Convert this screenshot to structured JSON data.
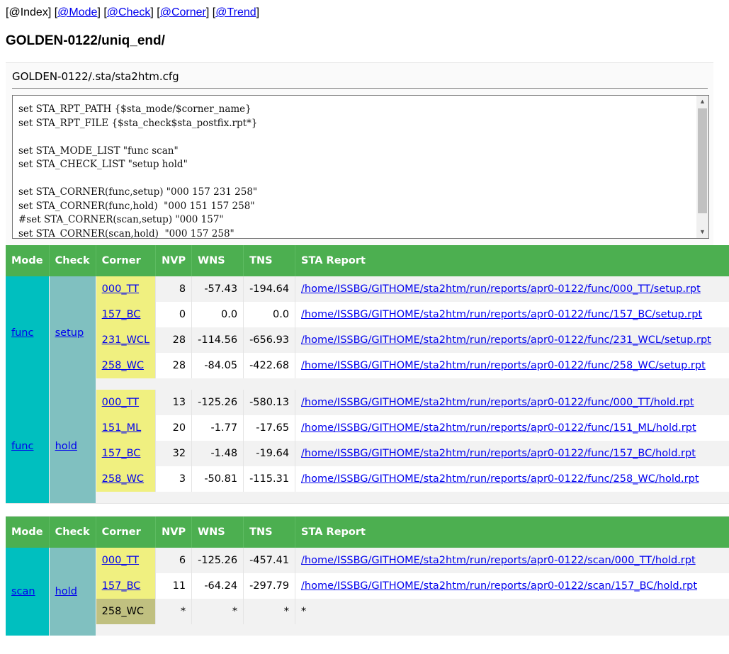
{
  "nav": {
    "index": "[@Index]",
    "links": [
      "@Mode",
      "@Check",
      "@Corner",
      "@Trend"
    ]
  },
  "title": "GOLDEN-0122/uniq_end/",
  "config": {
    "path": "GOLDEN-0122/.sta/sta2htm.cfg",
    "text": "set STA_RPT_PATH {$sta_mode/$corner_name}\nset STA_RPT_FILE {$sta_check$sta_postfix.rpt*}\n\nset STA_MODE_LIST \"func scan\"\nset STA_CHECK_LIST \"setup hold\"\n\nset STA_CORNER(func,setup) \"000 157 231 258\"\nset STA_CORNER(func,hold)  \"000 151 157 258\"\n#set STA_CORNER(scan,setup) \"000 157\"\nset STA_CORNER(scan,hold)  \"000 157 258\""
  },
  "headers": [
    "Mode",
    "Check",
    "Corner",
    "NVP",
    "WNS",
    "TNS",
    "STA Report"
  ],
  "table1": {
    "groups": [
      {
        "mode": "func",
        "check": "setup",
        "rows": [
          {
            "corner": "000_TT",
            "nvp": "8",
            "wns": "-57.43",
            "tns": "-194.64",
            "report": "/home/ISSBG/GITHOME/sta2htm/run/reports/apr0-0122/func/000_TT/setup.rpt"
          },
          {
            "corner": "157_BC",
            "nvp": "0",
            "wns": "0.0",
            "tns": "0.0",
            "report": "/home/ISSBG/GITHOME/sta2htm/run/reports/apr0-0122/func/157_BC/setup.rpt"
          },
          {
            "corner": "231_WCL",
            "nvp": "28",
            "wns": "-114.56",
            "tns": "-656.93",
            "report": "/home/ISSBG/GITHOME/sta2htm/run/reports/apr0-0122/func/231_WCL/setup.rpt"
          },
          {
            "corner": "258_WC",
            "nvp": "28",
            "wns": "-84.05",
            "tns": "-422.68",
            "report": "/home/ISSBG/GITHOME/sta2htm/run/reports/apr0-0122/func/258_WC/setup.rpt"
          }
        ]
      },
      {
        "mode": "func",
        "check": "hold",
        "rows": [
          {
            "corner": "000_TT",
            "nvp": "13",
            "wns": "-125.26",
            "tns": "-580.13",
            "report": "/home/ISSBG/GITHOME/sta2htm/run/reports/apr0-0122/func/000_TT/hold.rpt"
          },
          {
            "corner": "151_ML",
            "nvp": "20",
            "wns": "-1.77",
            "tns": "-17.65",
            "report": "/home/ISSBG/GITHOME/sta2htm/run/reports/apr0-0122/func/151_ML/hold.rpt"
          },
          {
            "corner": "157_BC",
            "nvp": "32",
            "wns": "-1.48",
            "tns": "-19.64",
            "report": "/home/ISSBG/GITHOME/sta2htm/run/reports/apr0-0122/func/157_BC/hold.rpt"
          },
          {
            "corner": "258_WC",
            "nvp": "3",
            "wns": "-50.81",
            "tns": "-115.31",
            "report": "/home/ISSBG/GITHOME/sta2htm/run/reports/apr0-0122/func/258_WC/hold.rpt"
          }
        ]
      }
    ]
  },
  "table2": {
    "groups": [
      {
        "mode": "scan",
        "check": "hold",
        "rows": [
          {
            "corner": "000_TT",
            "nvp": "6",
            "wns": "-125.26",
            "tns": "-457.41",
            "report": "/home/ISSBG/GITHOME/sta2htm/run/reports/apr0-0122/scan/000_TT/hold.rpt"
          },
          {
            "corner": "157_BC",
            "nvp": "11",
            "wns": "-64.24",
            "tns": "-297.79",
            "report": "/home/ISSBG/GITHOME/sta2htm/run/reports/apr0-0122/scan/157_BC/hold.rpt"
          },
          {
            "corner": "258_WC",
            "nvp": "*",
            "wns": "*",
            "tns": "*",
            "report": "*",
            "missing": true
          }
        ]
      }
    ]
  }
}
